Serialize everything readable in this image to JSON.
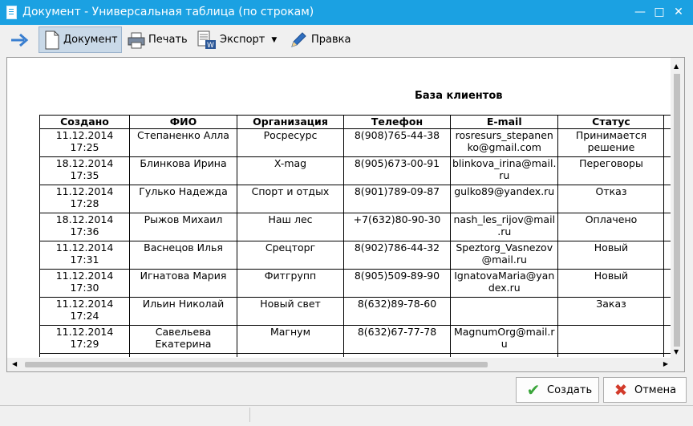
{
  "window": {
    "title": "Документ - Универсальная таблица (по строкам)",
    "minimize_glyph": "—",
    "maximize_glyph": "□",
    "close_glyph": "✕",
    "accent_color": "#1ba1e2"
  },
  "toolbar": {
    "back_icon": "arrow-right-icon",
    "document_label": "Документ",
    "print_label": "Печать",
    "export_label": "Экспорт",
    "edit_label": "Правка"
  },
  "report": {
    "title": "База клиентов",
    "columns": [
      "Создано",
      "ФИО",
      "Организация",
      "Телефон",
      "E-mail",
      "Статус"
    ],
    "rows": [
      {
        "created": "11.12.2014\n17:25",
        "name": "Степаненко Алла",
        "org": "Росресурс",
        "phone": "8(908)765-44-38",
        "email": "rosresurs_stepanen\nko@gmail.com",
        "status": "Принимается\nрешение"
      },
      {
        "created": "18.12.2014\n17:35",
        "name": "Блинкова Ирина",
        "org": "X-mag",
        "phone": "8(905)673-00-91",
        "email": "blinkova_irina@mail.\nru",
        "status": "Переговоры"
      },
      {
        "created": "11.12.2014\n17:28",
        "name": "Гулько Надежда",
        "org": "Спорт и отдых",
        "phone": "8(901)789-09-87",
        "email": "gulko89@yandex.ru",
        "status": "Отказ"
      },
      {
        "created": "18.12.2014\n17:36",
        "name": "Рыжов Михаил",
        "org": "Наш лес",
        "phone": "+7(632)80-90-30",
        "email": "nash_les_rijov@mail\n.ru",
        "status": "Оплачено"
      },
      {
        "created": "11.12.2014\n17:31",
        "name": "Васнецов Илья",
        "org": "Срецторг",
        "phone": "8(902)786-44-32",
        "email": "Speztorg_Vasnezov\n@mail.ru",
        "status": "Новый"
      },
      {
        "created": "11.12.2014\n17:30",
        "name": "Игнатова Мария",
        "org": "Фитгрупп",
        "phone": "8(905)509-89-90",
        "email": "IgnatovaMaria@yan\ndex.ru",
        "status": "Новый"
      },
      {
        "created": "11.12.2014\n17:24",
        "name": "Ильин Николай",
        "org": "Новый свет",
        "phone": "8(632)89-78-60",
        "email": "",
        "status": "Заказ"
      },
      {
        "created": "11.12.2014\n17:29",
        "name": "Савельева\nЕкатерина",
        "org": "Магнум",
        "phone": "8(632)67-77-78",
        "email": "MagnumOrg@mail.r\nu",
        "status": ""
      }
    ]
  },
  "buttons": {
    "create_label": "Создать",
    "cancel_label": "Отмена"
  }
}
